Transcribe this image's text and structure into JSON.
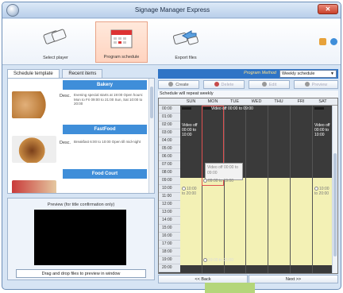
{
  "window": {
    "title": "Signage Manager Express",
    "close_label": "✕"
  },
  "toolbar": {
    "items": [
      {
        "label": "Select player",
        "icon": "player-icon"
      },
      {
        "label": "Program schedule",
        "icon": "calendar-icon"
      },
      {
        "label": "Export files",
        "icon": "export-icon"
      }
    ]
  },
  "left": {
    "tabs": [
      "Schedule template",
      "Recent items"
    ],
    "templates": [
      {
        "name": "Bakery",
        "desc_label": "Desc.",
        "desc": "Evening special starts at 19:00 Open hours: Mon to Fri 09:00 to 21:00 Sun, Sat 10:00 to 20:00"
      },
      {
        "name": "FastFood",
        "desc_label": "Desc.",
        "desc": "Breakfast 6:00 to 10:00 Open till mid-night"
      },
      {
        "name": "Food Court",
        "desc_label": "",
        "desc": ""
      }
    ],
    "preview_title": "Preview (for title confirmation only)",
    "drop_label": "Drag and drop files to preview in window"
  },
  "right": {
    "method_label": "Program Method",
    "method_value": "Weekly schedule",
    "actions": [
      {
        "label": "Create",
        "enabled": true
      },
      {
        "label": "Delete",
        "enabled": false
      },
      {
        "label": "Edit",
        "enabled": false
      },
      {
        "label": "Preview",
        "enabled": false
      }
    ],
    "repeat_text": "Schedule will repeat weekly",
    "days": [
      "SUN",
      "MON",
      "TUE",
      "WED",
      "THU",
      "FRI",
      "SAT"
    ],
    "corner": "",
    "hours": [
      "00:00",
      "01:00",
      "02:00",
      "03:00",
      "04:00",
      "05:00",
      "06:00",
      "07:00",
      "08:00",
      "09:00",
      "10:00",
      "11:00",
      "12:00",
      "13:00",
      "14:00",
      "15:00",
      "16:00",
      "17:00",
      "18:00",
      "19:00",
      "20:00"
    ],
    "events": {
      "mon_top": "Video off 00:00 to 09:00",
      "sun_off": "Video off 00:00 to 10:00",
      "tooltip": "Video off 00:00 to 09:00",
      "sat_off": "Video off 00:00 to 10:00",
      "mon_on": "09:00 to 19:00",
      "sun_on": "10:00 to 20:00",
      "sat_on": "10:00 to 20:00",
      "mon_evening": "19:00 to 21:00"
    },
    "back_label": "<< Back",
    "next_label": "Next >>"
  },
  "colors": {
    "accent": "#2f74c6",
    "template_header": "#3f8ed9",
    "on_time": "#f3f1b5",
    "off_time": "#3a3a3a",
    "selection": "#e05050"
  }
}
